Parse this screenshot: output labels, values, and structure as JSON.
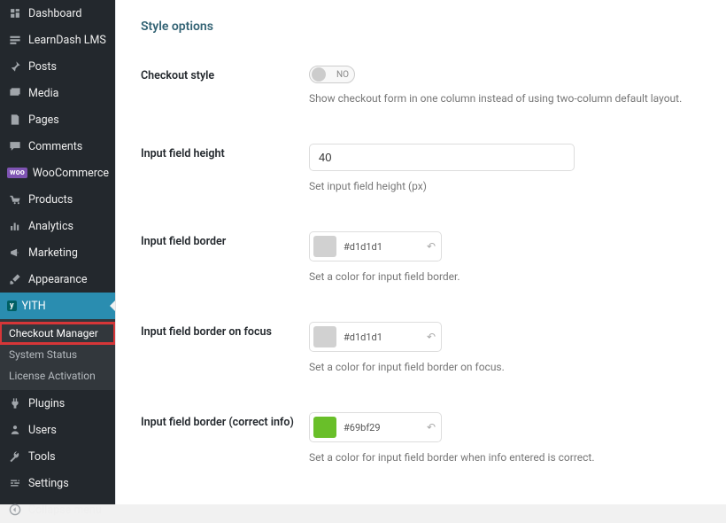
{
  "sidebar": {
    "items": [
      {
        "id": "dashboard",
        "label": "Dashboard"
      },
      {
        "id": "learndash",
        "label": "LearnDash LMS"
      },
      {
        "id": "posts",
        "label": "Posts"
      },
      {
        "id": "media",
        "label": "Media"
      },
      {
        "id": "pages",
        "label": "Pages"
      },
      {
        "id": "comments",
        "label": "Comments"
      },
      {
        "id": "woocommerce",
        "label": "WooCommerce"
      },
      {
        "id": "products",
        "label": "Products"
      },
      {
        "id": "analytics",
        "label": "Analytics"
      },
      {
        "id": "marketing",
        "label": "Marketing"
      },
      {
        "id": "appearance",
        "label": "Appearance"
      },
      {
        "id": "yith",
        "label": "YITH",
        "active": true
      },
      {
        "id": "plugins",
        "label": "Plugins"
      },
      {
        "id": "users",
        "label": "Users"
      },
      {
        "id": "tools",
        "label": "Tools"
      },
      {
        "id": "settings",
        "label": "Settings"
      },
      {
        "id": "collapse",
        "label": "Collapse menu"
      }
    ],
    "yith_submenu": [
      {
        "label": "Checkout Manager",
        "highlighted": true
      },
      {
        "label": "System Status"
      },
      {
        "label": "License Activation"
      }
    ]
  },
  "woo_badge_text": "woo",
  "yith_badge_text": "y",
  "page": {
    "section_title": "Style options"
  },
  "fields": {
    "checkout_style": {
      "label": "Checkout style",
      "toggle_state": "NO",
      "hint": "Show checkout form in one column instead of using two-column default layout."
    },
    "input_height": {
      "label": "Input field height",
      "value": "40",
      "hint": "Set input field height (px)"
    },
    "border": {
      "label": "Input field border",
      "hex": "#d1d1d1",
      "swatch": "#d1d1d1",
      "hint": "Set a color for input field border."
    },
    "border_focus": {
      "label": "Input field border on focus",
      "hex": "#d1d1d1",
      "swatch": "#d1d1d1",
      "hint": "Set a color for input field border on focus."
    },
    "border_correct": {
      "label": "Input field border (correct info)",
      "hex": "#69bf29",
      "swatch": "#69bf29",
      "hint": "Set a color for input field border when info entered is correct."
    }
  }
}
